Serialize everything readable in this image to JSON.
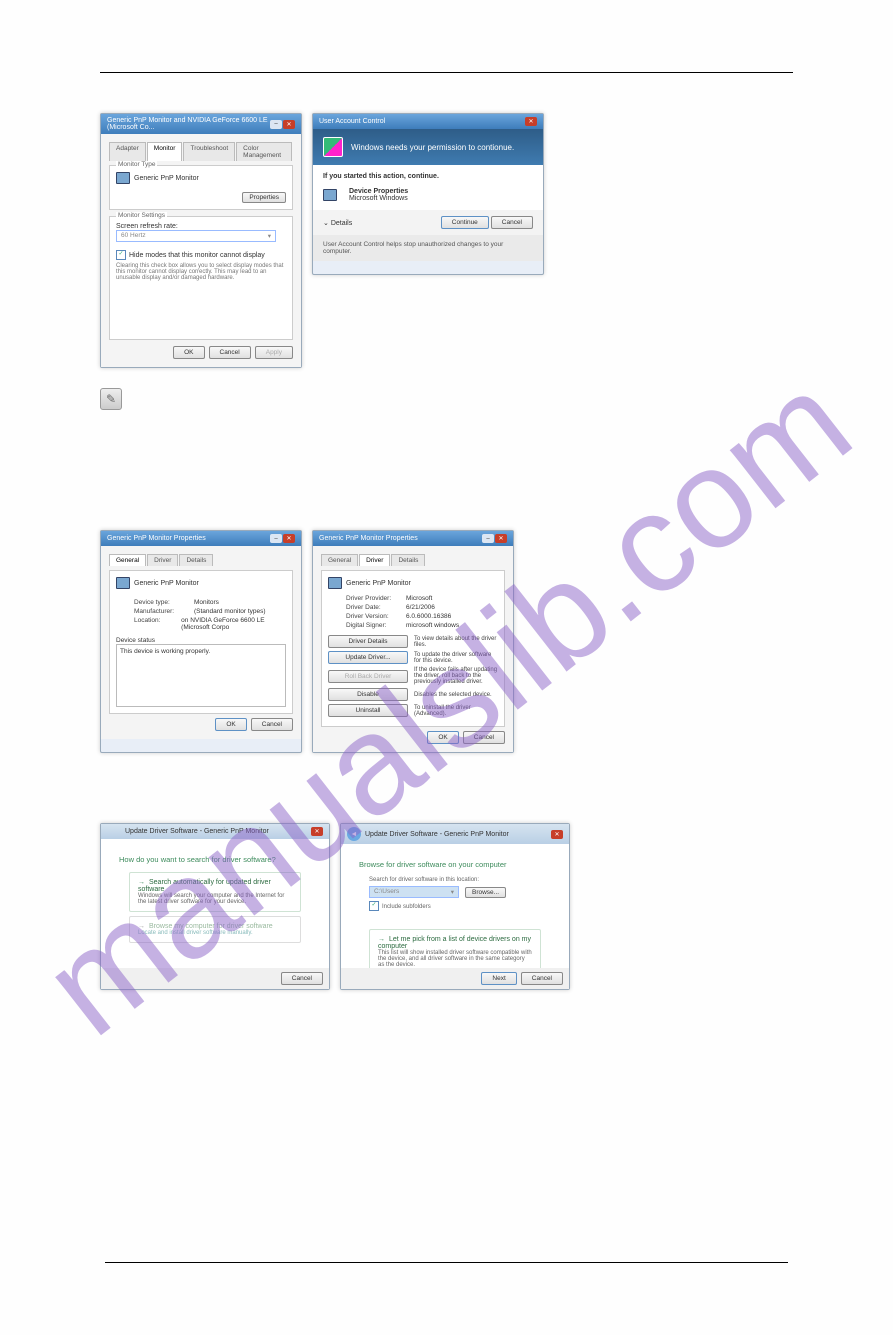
{
  "watermark": "manualslib.com",
  "monitor_dialog": {
    "title": "Generic PnP Monitor and NVIDIA GeForce 6600 LE (Microsoft Co...",
    "tabs": [
      "Adapter",
      "Monitor",
      "Troubleshoot",
      "Color Management"
    ],
    "active_tab": 1,
    "monitor_type_label": "Monitor Type",
    "monitor_name": "Generic PnP Monitor",
    "properties_btn": "Properties",
    "settings_label": "Monitor Settings",
    "refresh_label": "Screen refresh rate:",
    "refresh_value": "60 Hertz",
    "hide_modes": "Hide modes that this monitor cannot display",
    "hide_modes_desc": "Clearing this check box allows you to select display modes that this monitor cannot display correctly. This may lead to an unusable display and/or damaged hardware.",
    "ok": "OK",
    "cancel": "Cancel",
    "apply": "Apply"
  },
  "uac": {
    "titlebar": "User Account Control",
    "headline": "Windows needs your permission to contionue.",
    "started": "If you started this action, continue.",
    "app_name": "Device Properties",
    "app_vendor": "Microsoft Windows",
    "details": "Details",
    "continue": "Continue",
    "cancel": "Cancel",
    "footer": "User Account Control helps stop unauthorized changes to your computer."
  },
  "props_general": {
    "title": "Generic PnP Monitor Properties",
    "tabs": [
      "General",
      "Driver",
      "Details"
    ],
    "active_tab": 0,
    "device_name": "Generic PnP Monitor",
    "rows": [
      {
        "k": "Device type:",
        "v": "Monitors"
      },
      {
        "k": "Manufacturer:",
        "v": "(Standard monitor types)"
      },
      {
        "k": "Location:",
        "v": "on NVIDIA GeForce 6600 LE (Microsoft Corpo"
      }
    ],
    "status_label": "Device status",
    "status_text": "This device is working properly.",
    "ok": "OK",
    "cancel": "Cancel"
  },
  "props_driver": {
    "title": "Generic PnP Monitor Properties",
    "tabs": [
      "General",
      "Driver",
      "Details"
    ],
    "active_tab": 1,
    "device_name": "Generic PnP Monitor",
    "rows": [
      {
        "k": "Driver Provider:",
        "v": "Microsoft"
      },
      {
        "k": "Driver Date:",
        "v": "6/21/2006"
      },
      {
        "k": "Driver Version:",
        "v": "6.0.6000.16386"
      },
      {
        "k": "Digital Signer:",
        "v": "microsoft windows"
      }
    ],
    "buttons": [
      {
        "label": "Driver Details",
        "desc": "To view details about the driver files."
      },
      {
        "label": "Update Driver...",
        "desc": "To update the driver software for this device."
      },
      {
        "label": "Roll Back Driver",
        "desc": "If the device fails after updating the driver, roll back to the previously installed driver.",
        "disabled": true
      },
      {
        "label": "Disable",
        "desc": "Disables the selected device."
      },
      {
        "label": "Uninstall",
        "desc": "To uninstall the driver (Advanced)."
      }
    ],
    "ok": "OK",
    "cancel": "Cancel"
  },
  "wizard_search": {
    "title": "Update Driver Software - Generic PnP Monitor",
    "question": "How do you want to search for driver software?",
    "opt1_title": "Search automatically for updated driver software",
    "opt1_desc": "Windows will search your computer and the Internet for the latest driver software for your device.",
    "opt2_title": "Browse my computer for driver software",
    "opt2_desc": "Locate and install driver software manually.",
    "cancel": "Cancel"
  },
  "wizard_browse": {
    "title": "Update Driver Software - Generic PnP Monitor",
    "heading": "Browse for driver software on your computer",
    "search_label": "Search for driver software in this location:",
    "path_value": "C:\\Users",
    "browse": "Browse...",
    "include_sub": "Include subfolders",
    "pick_title": "Let me pick from a list of device drivers on my computer",
    "pick_desc": "This list will show installed driver software compatible with the device, and all driver software in the same category as the device.",
    "next": "Next",
    "cancel": "Cancel"
  }
}
